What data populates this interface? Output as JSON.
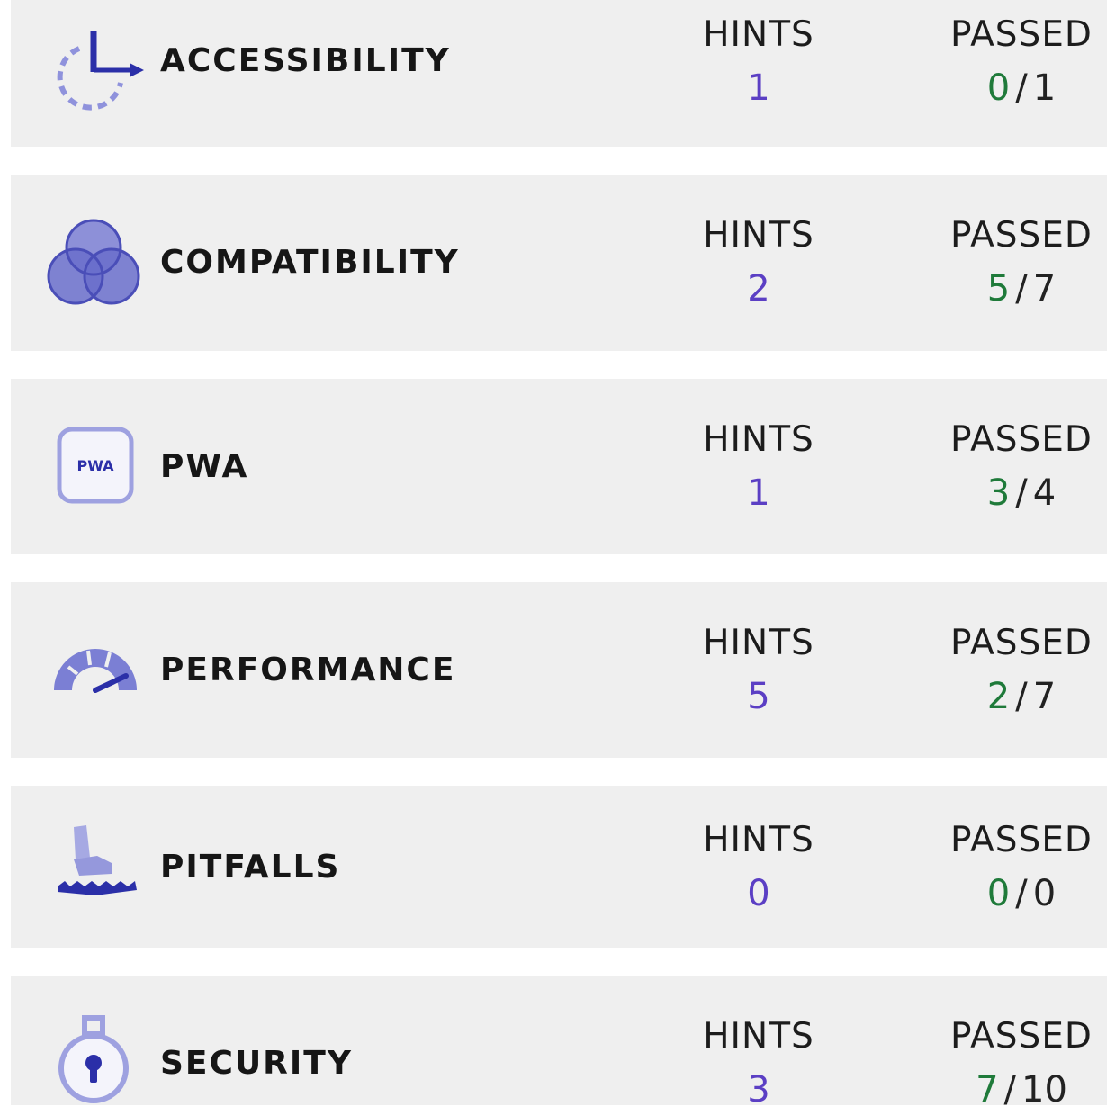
{
  "column_headers": {
    "hints": "HINTS",
    "passed": "PASSED"
  },
  "colors": {
    "card_background": "#efefef",
    "hints_value": "#5b3fc4",
    "passed_value": "#1f7a3a",
    "icon_fill": "#7b7fd4",
    "icon_dark": "#2b2fa8"
  },
  "categories": [
    {
      "label": "ACCESSIBILITY",
      "icon": "accessibility-icon",
      "hints": "1",
      "passed": "0",
      "total": "1"
    },
    {
      "label": "COMPATIBILITY",
      "icon": "compatibility-icon",
      "hints": "2",
      "passed": "5",
      "total": "7"
    },
    {
      "label": "PWA",
      "icon": "pwa-icon",
      "icon_text": "PWA",
      "hints": "1",
      "passed": "3",
      "total": "4"
    },
    {
      "label": "PERFORMANCE",
      "icon": "performance-gauge-icon",
      "hints": "5",
      "passed": "2",
      "total": "7"
    },
    {
      "label": "PITFALLS",
      "icon": "pitfalls-icon",
      "hints": "0",
      "passed": "0",
      "total": "0"
    },
    {
      "label": "SECURITY",
      "icon": "security-lock-icon",
      "hints": "3",
      "passed": "7",
      "total": "10"
    }
  ]
}
